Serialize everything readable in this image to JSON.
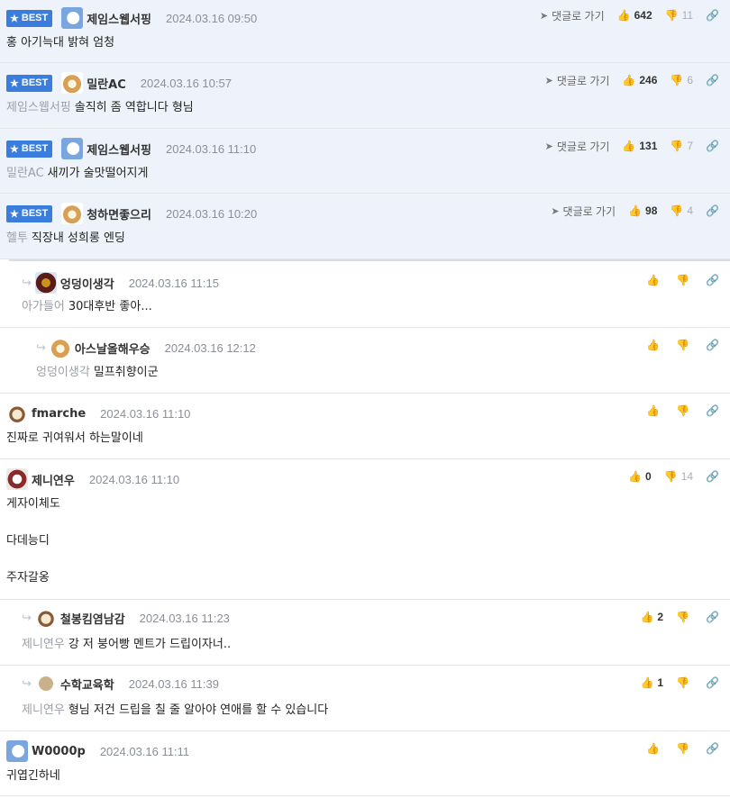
{
  "labels": {
    "best": "BEST",
    "goto": "댓글로 가기"
  },
  "icons": {
    "star": "★",
    "goto": "➤",
    "like": "👍",
    "dislike": "👎",
    "link": "🔗",
    "reply": "↪"
  },
  "comments": [
    {
      "nick": "제임스웹서핑",
      "date": "2024.03.16 09:50",
      "mention": "",
      "text": "홍 아기늑대 밝혀 엄청",
      "up": "642",
      "down": "11"
    },
    {
      "nick": "밀란AC",
      "date": "2024.03.16 10:57",
      "mention": "제임스웹서핑",
      "text": "솔직히 좀 역합니다 형님",
      "up": "246",
      "down": "6"
    },
    {
      "nick": "제임스웹서핑",
      "date": "2024.03.16 11:10",
      "mention": "밀란AC",
      "text": "새끼가 술맛떨어지게",
      "up": "131",
      "down": "7"
    },
    {
      "nick": "청하면좋으리",
      "date": "2024.03.16 10:20",
      "mention": "헬투",
      "text": "직장내 성희롱 엔딩",
      "up": "98",
      "down": "4"
    },
    {
      "nick": "엉덩이생각",
      "date": "2024.03.16 11:15",
      "mention": "아가들어",
      "text": "30대후반 좋아..."
    },
    {
      "nick": "아스날올해우승",
      "date": "2024.03.16 12:12",
      "mention": "엉덩이생각",
      "text": "밀프취향이군"
    },
    {
      "nick": "fmarche",
      "date": "2024.03.16 11:10",
      "text": "진짜로 귀여워서 하는말이네"
    },
    {
      "nick": "제니연우",
      "date": "2024.03.16 11:10",
      "lines": [
        "게자이체도",
        "다데능디",
        "주자갈옹"
      ],
      "up": "0",
      "down": "14"
    },
    {
      "nick": "철봉킴염남감",
      "date": "2024.03.16 11:23",
      "mention": "제니연우",
      "text": "강 저 붕어빵 멘트가 드립이자너..",
      "up": "2"
    },
    {
      "nick": "수학교육학",
      "date": "2024.03.16 11:39",
      "mention": "제니연우",
      "text": "형님 저건 드립을 칠 줄 알아야 연애를 할 수 있습니다",
      "up": "1"
    },
    {
      "nick": "W0000p",
      "date": "2024.03.16 11:11",
      "text": "귀엽긴하네"
    }
  ]
}
